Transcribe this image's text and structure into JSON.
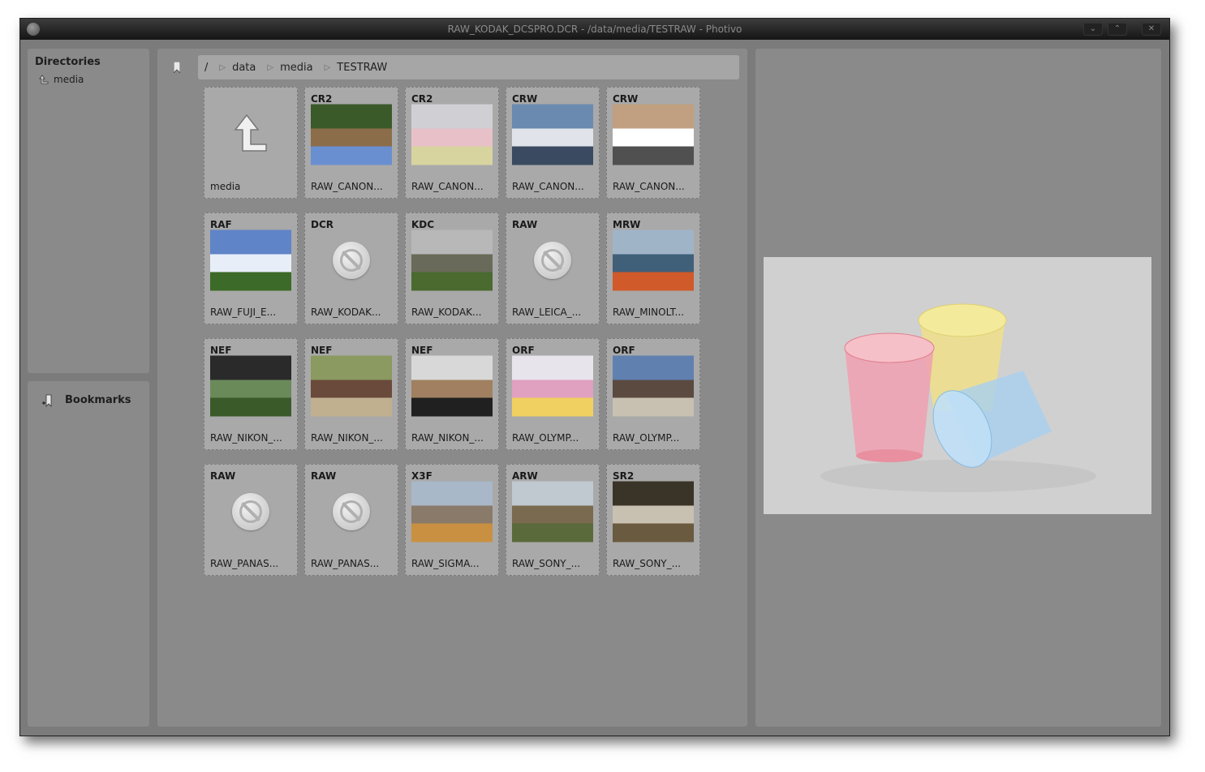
{
  "window": {
    "title": "RAW_KODAK_DCSPRO.DCR - /data/media/TESTRAW - Photivo",
    "btn_minimize": "⌄",
    "btn_maximize": "⌃",
    "btn_close": "✕"
  },
  "sidebar": {
    "directories_title": "Directories",
    "directories": [
      {
        "label": "media",
        "icon": "up-arrow-icon"
      }
    ],
    "bookmarks_title": "Bookmarks"
  },
  "breadcrumb": [
    "/",
    "data",
    "media",
    "TESTRAW"
  ],
  "thumbnails": [
    {
      "type": "",
      "name": "media",
      "kind": "up"
    },
    {
      "type": "CR2",
      "name": "RAW_CANON...",
      "kind": "photo",
      "colors": [
        "#3a5a2a",
        "#8c6d4a",
        "#6a8fd0"
      ]
    },
    {
      "type": "CR2",
      "name": "RAW_CANON...",
      "kind": "photo",
      "colors": [
        "#d0d0d4",
        "#e8c0c8",
        "#d8d4a0"
      ]
    },
    {
      "type": "CRW",
      "name": "RAW_CANON...",
      "kind": "photo",
      "colors": [
        "#6a8ab0",
        "#e0e4ea",
        "#3a4a60"
      ]
    },
    {
      "type": "CRW",
      "name": "RAW_CANON...",
      "kind": "photo",
      "colors": [
        "#c0a080",
        "#ffffff",
        "#505050"
      ]
    },
    {
      "type": "RAF",
      "name": "RAW_FUJI_E...",
      "kind": "photo",
      "colors": [
        "#5f84c8",
        "#e8eef8",
        "#3c6a28"
      ]
    },
    {
      "type": "DCR",
      "name": "RAW_KODAK...",
      "kind": "none"
    },
    {
      "type": "KDC",
      "name": "RAW_KODAK...",
      "kind": "photo",
      "colors": [
        "#b8b8b8",
        "#6a6a5a",
        "#4a6a30"
      ]
    },
    {
      "type": "RAW",
      "name": "RAW_LEICA_...",
      "kind": "none"
    },
    {
      "type": "MRW",
      "name": "RAW_MINOLT...",
      "kind": "photo",
      "colors": [
        "#a0b4c8",
        "#40607a",
        "#d05a2a"
      ]
    },
    {
      "type": "NEF",
      "name": "RAW_NIKON_...",
      "kind": "photo",
      "colors": [
        "#2a2a2a",
        "#6a8a5a",
        "#3a5a2a"
      ]
    },
    {
      "type": "NEF",
      "name": "RAW_NIKON_...",
      "kind": "photo",
      "colors": [
        "#8a9a60",
        "#6a4a3a",
        "#c0b090"
      ]
    },
    {
      "type": "NEF",
      "name": "RAW_NIKON_...",
      "kind": "photo",
      "colors": [
        "#d8d8d8",
        "#a08060",
        "#202020"
      ]
    },
    {
      "type": "ORF",
      "name": "RAW_OLYMP...",
      "kind": "photo",
      "colors": [
        "#e8e4ec",
        "#e0a0c0",
        "#f0d060"
      ]
    },
    {
      "type": "ORF",
      "name": "RAW_OLYMP...",
      "kind": "photo",
      "colors": [
        "#6080b0",
        "#5a4a40",
        "#c8c0b0"
      ]
    },
    {
      "type": "RAW",
      "name": "RAW_PANAS...",
      "kind": "none"
    },
    {
      "type": "RAW",
      "name": "RAW_PANAS...",
      "kind": "none"
    },
    {
      "type": "X3F",
      "name": "RAW_SIGMA...",
      "kind": "photo",
      "colors": [
        "#a8b8c8",
        "#8a7a6a",
        "#c89040"
      ]
    },
    {
      "type": "ARW",
      "name": "RAW_SONY_...",
      "kind": "photo",
      "colors": [
        "#c0c8d0",
        "#7a6a50",
        "#5a6a3a"
      ]
    },
    {
      "type": "SR2",
      "name": "RAW_SONY_...",
      "kind": "photo",
      "colors": [
        "#3a3428",
        "#c8c0b0",
        "#6a5a40"
      ]
    }
  ],
  "colors": {
    "panel": "#8a8a8a",
    "window_bg": "#7b7b7b",
    "thumb_bg": "#a9a9a9"
  }
}
